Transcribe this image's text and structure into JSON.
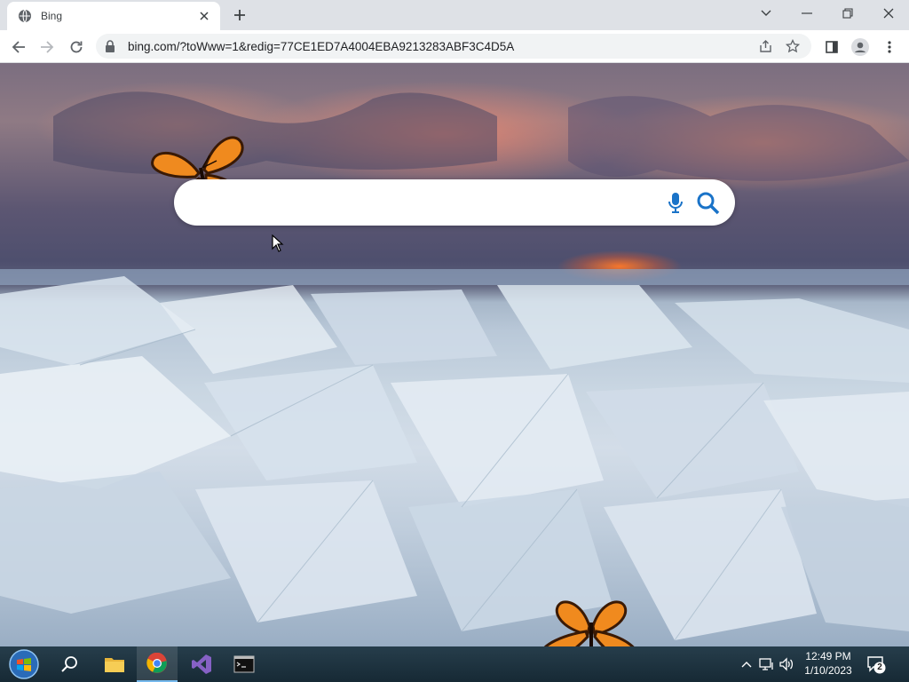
{
  "browser": {
    "tab": {
      "title": "Bing",
      "favicon": "globe-icon",
      "close_icon": "close-icon"
    },
    "new_tab_icon": "plus-icon",
    "window_controls": [
      "chevron-down-icon",
      "minimize-icon",
      "restore-icon",
      "close-icon"
    ],
    "nav": [
      "back-arrow-icon",
      "forward-arrow-icon",
      "reload-icon"
    ],
    "address_bar": {
      "lock_icon": "lock-icon",
      "url": "bing.com/?toWww=1&redig=77CE1ED7A4004EBA9213283ABF3C4D5A"
    },
    "address_actions": [
      "share-icon",
      "star-icon"
    ],
    "toolbar_right": [
      "side-panel-icon",
      "profile-icon",
      "kebab-menu-icon"
    ]
  },
  "page": {
    "search": {
      "value": "",
      "mic_icon": "microphone-icon",
      "search_icon": "magnifier-icon"
    },
    "decorations": [
      "butterfly-icon",
      "butterfly-icon"
    ],
    "accent_color": "#1a73c8"
  },
  "taskbar": {
    "items": [
      "windows-start-icon",
      "search-icon",
      "file-explorer-icon",
      "chrome-icon",
      "visual-studio-icon",
      "terminal-icon"
    ],
    "tray": [
      "chevron-up-icon",
      "network-icon",
      "volume-icon"
    ],
    "clock": {
      "time": "12:49 PM",
      "date": "1/10/2023"
    },
    "notifications": {
      "icon": "action-center-icon",
      "count": "2"
    }
  }
}
